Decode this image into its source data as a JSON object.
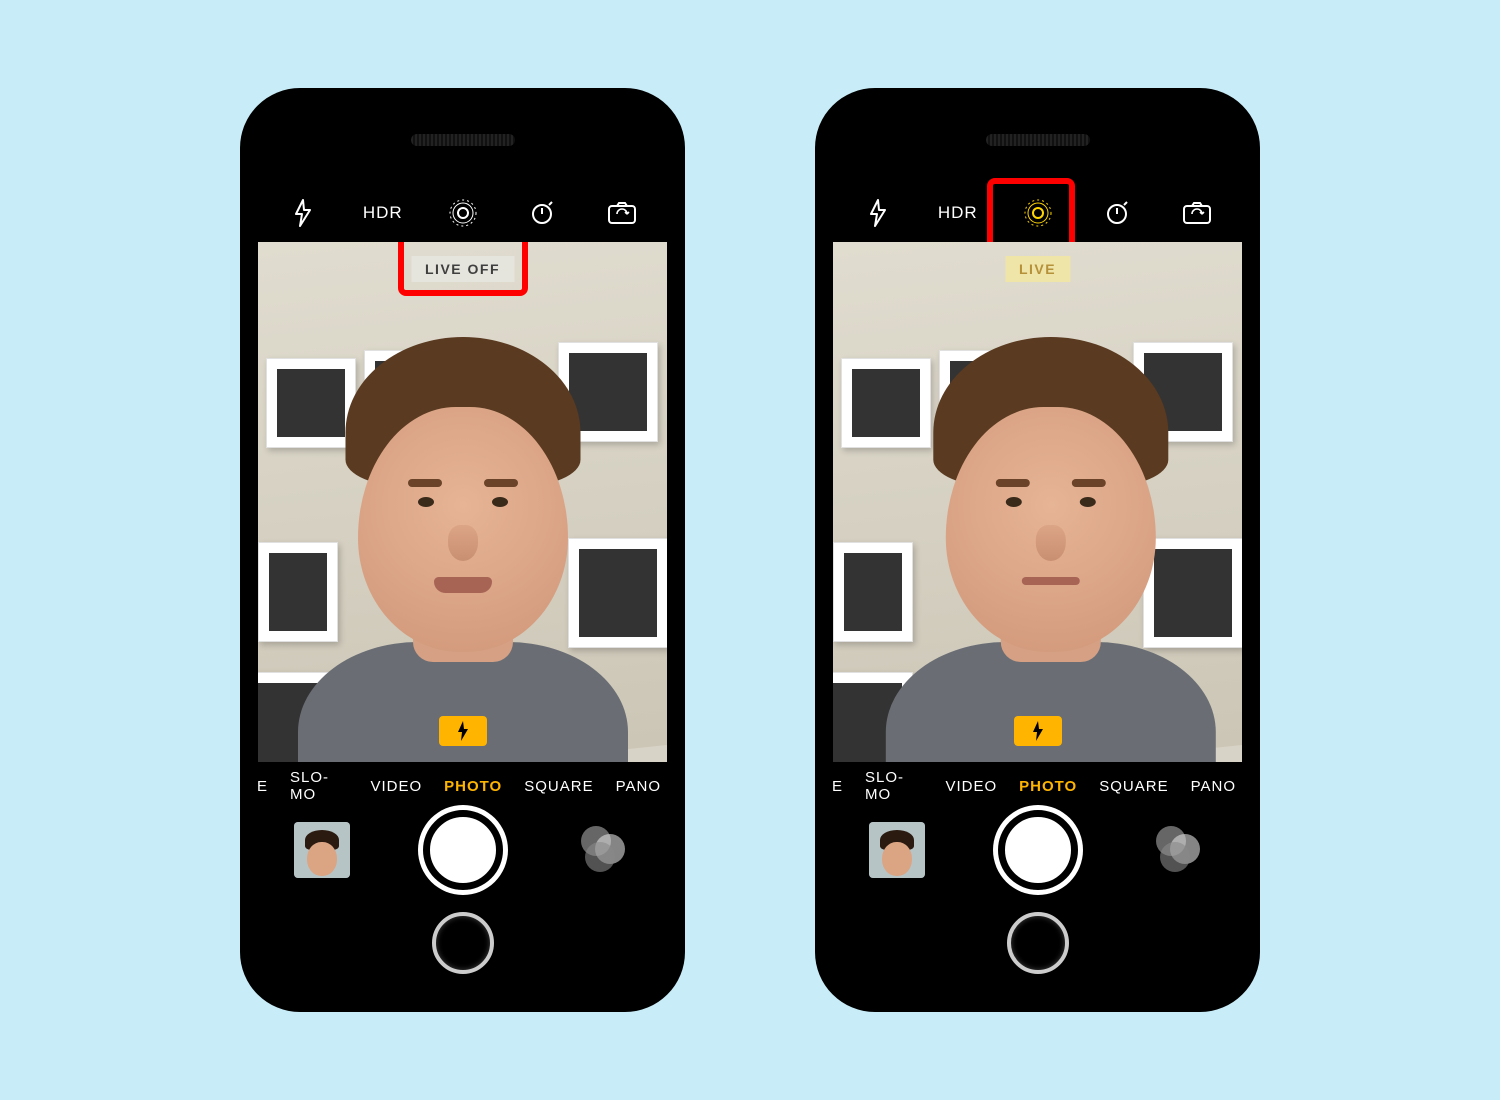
{
  "phones": {
    "left": {
      "toolbar_hdr": "HDR",
      "live_photo_state": "off",
      "live_label": "LIVE OFF",
      "flash_warning": true,
      "highlight_target": "live-label"
    },
    "right": {
      "toolbar_hdr": "HDR",
      "live_photo_state": "on",
      "live_label": "LIVE",
      "flash_warning": true,
      "highlight_target": "live-icon"
    }
  },
  "modes": {
    "items": [
      "SE",
      "SLO-MO",
      "VIDEO",
      "PHOTO",
      "SQUARE",
      "PANO"
    ],
    "active": "PHOTO"
  },
  "icons": {
    "flash": "flash-icon",
    "live_photo": "live-photo-icon",
    "timer": "timer-icon",
    "flip": "camera-flip-icon",
    "filters": "filters-icon",
    "shutter": "shutter-button",
    "thumbnail": "last-photo-thumbnail",
    "flash_badge": "flash-warning-badge"
  },
  "colors": {
    "accent": "#ffb400",
    "highlight": "#ff0000",
    "background": "#c8edf8",
    "live_on": "#ffd400"
  }
}
